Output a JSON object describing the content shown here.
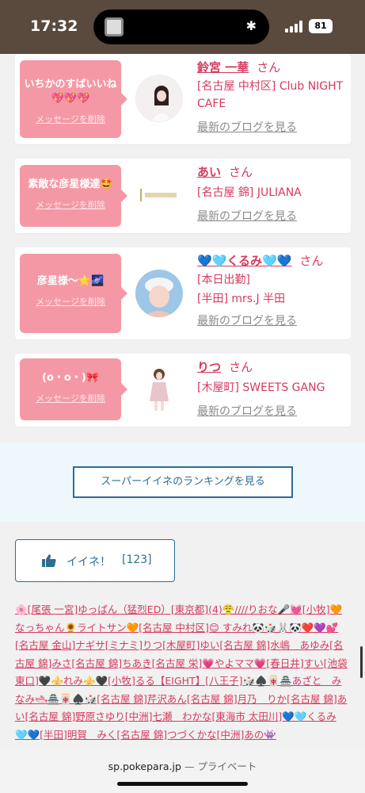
{
  "status": {
    "time": "17:32",
    "battery": "81"
  },
  "cards": [
    {
      "message": "いちかのすばいいね💖💖💖",
      "delete_label": "メッセージを削除",
      "name": "鈴宮 一華",
      "suffix": "さん",
      "line1": "[名古屋 中村区] Club NIGHT CAFE",
      "line2": "",
      "blog_label": "最新のブログを見る",
      "avatar": "woman-portrait"
    },
    {
      "message": "素敵な彦星様達🤩",
      "delete_label": "メッセージを削除",
      "name": "あい",
      "suffix": "さん",
      "line1": "[名古屋 錦] JULIANA",
      "line2": "",
      "blog_label": "最新のブログを見る",
      "avatar": "juliana-logo"
    },
    {
      "message": "彦星様〜⭐️🌌",
      "delete_label": "メッセージを削除",
      "name": "💙🩵くるみ🩵💙",
      "suffix": "さん",
      "line1": "[本日出勤]",
      "line2": "[半田] mrs.J 半田",
      "blog_label": "最新のブログを見る",
      "avatar": "woman-cap"
    },
    {
      "message": "(o・o・)🎀",
      "delete_label": "メッセージを削除",
      "name": "りつ",
      "suffix": "さん",
      "line1": "[木屋町] SWEETS GANG",
      "line2": "",
      "blog_label": "最新のブログを見る",
      "avatar": "woman-standing"
    }
  ],
  "ranking_button": "スーパーイイネのランキングを見る",
  "like_button": {
    "label": "イイネ！",
    "count": "[123]"
  },
  "links_text": "🌸[尾張 一宮]ゆっぱん（猛烈ED）[東京都](4)😤////りおな🎤💓[小牧]🧡なっちゃん🌻ライトサン🧡[名古屋 中村区]😊 すみれ🐼🎲🐰🐼❤️💜💕[名古屋 金山]ナギサ[ミナミ]りつ[木屋町]ゆい[名古屋 錦]水嶋　あゆみ[名古屋 錦]みさ[名古屋 錦]ちあき[名古屋 栄]💗やよママ💗[春日井]すい[池袋東口]🖤⚜️れみ⚜️🖤[小牧]るる【EIGHT】[八王子]🎲♠️🀄️🏯あざと　みなみ🛥🏯🀄️♠️🎲[名古屋 錦]芹沢あん[名古屋 錦]月乃　りか[名古屋 錦]あい[名古屋 錦]野原さゆり[中洲]七瀬　わかな[東海市 太田川]💙🩵くるみ🩵💙[半田]明賀　みく[名古屋 錦]つづくかな[中洲]あの👾",
  "browser": {
    "domain": "sp.pokepara.jp",
    "separator": "—",
    "mode": "プライベート"
  }
}
